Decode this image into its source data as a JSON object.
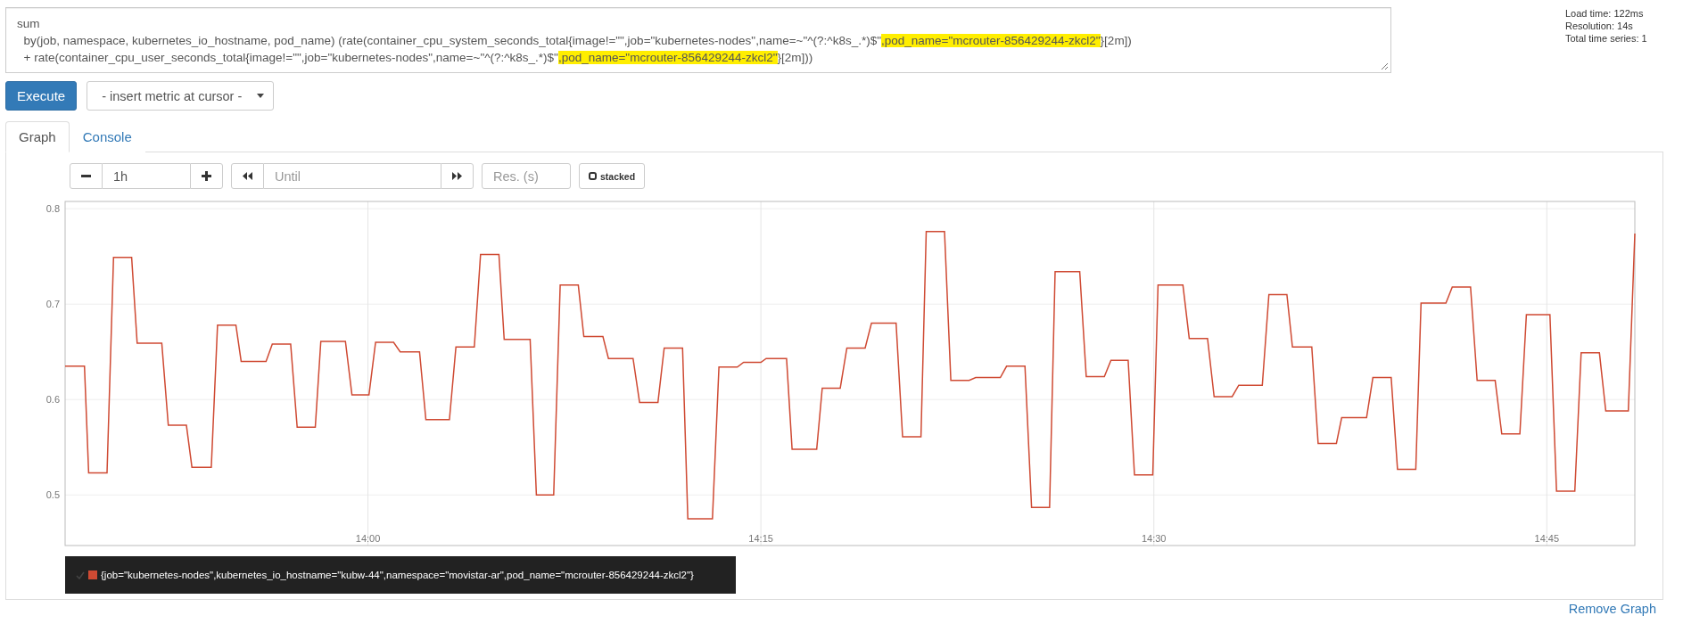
{
  "query": {
    "lines": [
      [
        {
          "text": "sum",
          "highlighted": false
        }
      ],
      [
        {
          "text": "  by(job, namespace, kubernetes_io_hostname, pod_name) (rate(container_cpu_system_seconds_total{image!=\"\",job=\"kubernetes-nodes\",name=~\"^(?:^k8s_.*)$\"",
          "highlighted": false
        },
        {
          "text": ",pod_name=\"mcrouter-856429244-zkcl2\"",
          "highlighted": true
        },
        {
          "text": "}[2m])",
          "highlighted": false
        }
      ],
      [
        {
          "text": "  + rate(container_cpu_user_seconds_total{image!=\"\",job=\"kubernetes-nodes\",name=~\"^(?:^k8s_.*)$\"",
          "highlighted": false
        },
        {
          "text": ",pod_name=\"mcrouter-856429244-zkcl2\"",
          "highlighted": true
        },
        {
          "text": "}[2m]))",
          "highlighted": false
        }
      ]
    ]
  },
  "stats": [
    "Load time: 122ms",
    "Resolution: 14s",
    "Total time series: 1"
  ],
  "execute_button": "Execute",
  "metric_select": "- insert metric at cursor -",
  "tabs": [
    {
      "label": "Graph",
      "selected": true
    },
    {
      "label": "Console",
      "selected": false
    }
  ],
  "controls": {
    "range": "1h",
    "end_placeholder": "Until",
    "resolution_placeholder": "Res. (s)",
    "stacked": {
      "label": "stacked",
      "checked": false
    }
  },
  "chart": {
    "chart_data": {
      "type": "line",
      "grid": true,
      "xlim": [
        828.44,
        888.36
      ],
      "ylim": [
        0.447,
        0.8076
      ],
      "xticks": [
        {
          "value": 840,
          "label": "14:00"
        },
        {
          "value": 855,
          "label": "14:15"
        },
        {
          "value": 870,
          "label": "14:30"
        },
        {
          "value": 885,
          "label": "14:45"
        }
      ],
      "yticks": [
        0.5,
        0.6,
        0.7,
        0.8
      ],
      "x": [
        828.44,
        829.18,
        829.34,
        830.04,
        830.29,
        830.98,
        831.19,
        832.13,
        832.38,
        833.07,
        833.28,
        834.02,
        834.26,
        834.96,
        835.16,
        836.11,
        836.35,
        837.05,
        837.3,
        837.99,
        838.2,
        839.14,
        839.39,
        840.04,
        840.29,
        840.98,
        841.23,
        841.97,
        842.21,
        843.11,
        843.36,
        844.06,
        844.3,
        845.0,
        845.2,
        846.19,
        846.43,
        847.09,
        847.34,
        848.03,
        848.24,
        848.97,
        849.18,
        850.12,
        850.37,
        851.07,
        851.31,
        852.01,
        852.21,
        853.15,
        853.4,
        854.1,
        854.34,
        855.0,
        855.2,
        855.98,
        856.19,
        857.13,
        857.34,
        858.03,
        858.28,
        858.98,
        859.22,
        860.16,
        860.41,
        861.11,
        861.31,
        862.01,
        862.25,
        862.95,
        863.2,
        864.14,
        864.38,
        865.08,
        865.33,
        866.02,
        866.23,
        867.17,
        867.42,
        868.11,
        868.36,
        869.02,
        869.26,
        869.96,
        870.16,
        871.11,
        871.35,
        872.05,
        872.3,
        872.99,
        873.24,
        874.14,
        874.39,
        875.08,
        875.29,
        876.03,
        876.27,
        876.97,
        877.17,
        878.12,
        878.36,
        879.06,
        879.3,
        880.0,
        880.2,
        881.15,
        881.39,
        882.09,
        882.34,
        883.03,
        883.28,
        883.97,
        884.22,
        885.12,
        885.37,
        886.07,
        886.31,
        887.01,
        887.25,
        888.11,
        888.36
      ],
      "series": [
        {
          "name": "{job=\"kubernetes-nodes\",kubernetes_io_hostname=\"kubw-44\",namespace=\"movistar-ar\",pod_name=\"mcrouter-856429244-zkcl2\"}",
          "color": "#cf4a33",
          "values": [
            0.635,
            0.635,
            0.523,
            0.523,
            0.749,
            0.749,
            0.659,
            0.659,
            0.573,
            0.573,
            0.529,
            0.529,
            0.678,
            0.678,
            0.64,
            0.64,
            0.658,
            0.658,
            0.571,
            0.571,
            0.661,
            0.661,
            0.605,
            0.605,
            0.66,
            0.66,
            0.65,
            0.65,
            0.579,
            0.579,
            0.655,
            0.655,
            0.752,
            0.752,
            0.663,
            0.663,
            0.5,
            0.5,
            0.72,
            0.72,
            0.666,
            0.666,
            0.643,
            0.643,
            0.597,
            0.597,
            0.654,
            0.654,
            0.475,
            0.475,
            0.634,
            0.634,
            0.639,
            0.639,
            0.643,
            0.643,
            0.548,
            0.548,
            0.612,
            0.612,
            0.654,
            0.654,
            0.68,
            0.68,
            0.561,
            0.561,
            0.776,
            0.776,
            0.62,
            0.62,
            0.623,
            0.623,
            0.635,
            0.635,
            0.487,
            0.487,
            0.734,
            0.734,
            0.624,
            0.624,
            0.641,
            0.641,
            0.521,
            0.521,
            0.72,
            0.72,
            0.664,
            0.664,
            0.603,
            0.603,
            0.615,
            0.615,
            0.71,
            0.71,
            0.655,
            0.655,
            0.554,
            0.554,
            0.581,
            0.581,
            0.623,
            0.623,
            0.527,
            0.527,
            0.701,
            0.701,
            0.718,
            0.718,
            0.62,
            0.62,
            0.564,
            0.564,
            0.689,
            0.689,
            0.504,
            0.504,
            0.649,
            0.649,
            0.588,
            0.588,
            0.774
          ]
        }
      ]
    }
  },
  "remove_link": "Remove Graph"
}
